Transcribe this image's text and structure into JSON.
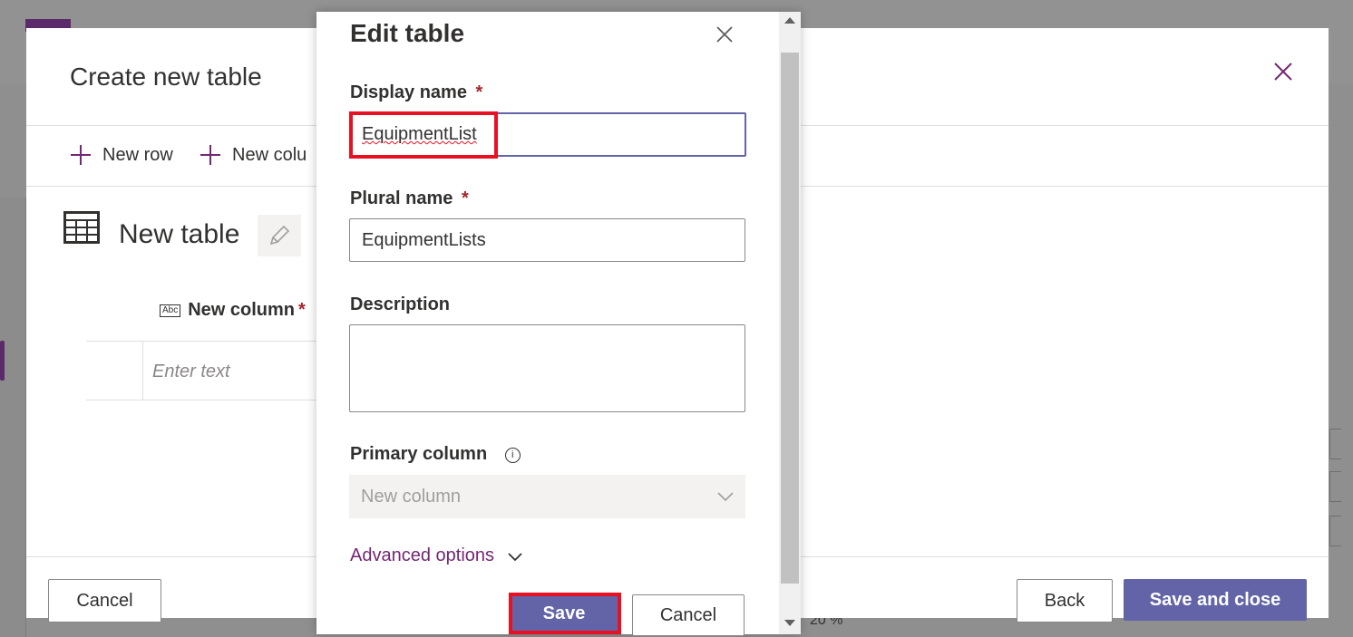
{
  "background": {
    "zoom_label": "20  %"
  },
  "create_dialog": {
    "title": "Create new table",
    "toolbar": {
      "new_row_label": "New row",
      "new_column_label": "New colu"
    },
    "table_name": "New table",
    "column_header": "New column",
    "required_marker": "*",
    "cell_placeholder": "Enter text",
    "footer": {
      "cancel_label": "Cancel",
      "back_label": "Back",
      "save_and_close_label": "Save and close"
    }
  },
  "edit_panel": {
    "title": "Edit table",
    "display_name": {
      "label": "Display name",
      "required_marker": "*",
      "value": "EquipmentList"
    },
    "plural_name": {
      "label": "Plural name",
      "required_marker": "*",
      "value": "EquipmentLists"
    },
    "description": {
      "label": "Description",
      "value": ""
    },
    "primary_column": {
      "label": "Primary column",
      "info_icon_glyph": "i",
      "value": "New column"
    },
    "advanced_options_label": "Advanced options",
    "save_label": "Save",
    "cancel_label": "Cancel"
  },
  "colors": {
    "accent": "#6264a7",
    "link": "#742774",
    "highlight": "#e81123",
    "required": "#a4262c"
  },
  "icons": [
    "close-icon",
    "add-icon",
    "table-grid-icon",
    "pencil-icon",
    "abc-text-icon",
    "info-icon",
    "chevron-down-icon"
  ]
}
